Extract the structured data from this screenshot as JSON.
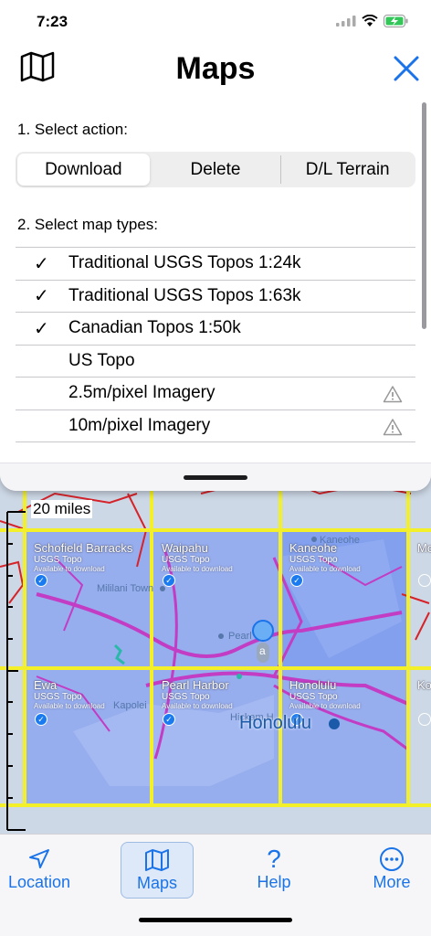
{
  "status_bar": {
    "time": "7:23"
  },
  "header": {
    "title": "Maps",
    "map_icon": "map-icon",
    "close_icon": "close-icon"
  },
  "action_section": {
    "label": "1. Select action:",
    "options": [
      "Download",
      "Delete",
      "D/L Terrain"
    ],
    "selected": "Download"
  },
  "map_types_section": {
    "label": "2. Select map types:",
    "items": [
      {
        "label": "Traditional USGS Topos 1:24k",
        "checked": "✓"
      },
      {
        "label": "Traditional USGS Topos 1:63k",
        "checked": "✓"
      },
      {
        "label": "Canadian Topos 1:50k",
        "checked": "✓"
      },
      {
        "label": "US Topo",
        "checked": ""
      },
      {
        "label": "2.5m/pixel Imagery",
        "checked": "",
        "warning_icon": "warning-icon"
      },
      {
        "label": "10m/pixel Imagery",
        "checked": "",
        "warning_icon": "warning-icon"
      }
    ]
  },
  "map": {
    "scale_label": "20 miles",
    "tiles": [
      {
        "name": "Schofield Barracks",
        "series": "USGS Topo",
        "status": "Available to download"
      },
      {
        "name": "Waipahu",
        "series": "USGS Topo",
        "status": "Available to download"
      },
      {
        "name": "Kaneohe",
        "series": "USGS Topo",
        "status": "Available to download"
      },
      {
        "name": "Ewa",
        "series": "USGS Topo",
        "status": "Available to download"
      },
      {
        "name": "Pearl Harbor",
        "series": "USGS Topo",
        "status": "Available to download"
      },
      {
        "name": "Honolulu",
        "series": "USGS Topo",
        "status": "Available to download"
      }
    ],
    "places": {
      "mililani": "Mililani Town",
      "pearl": "Pearl",
      "kapolei": "Kapolei",
      "kaneohe": "Kaneohe",
      "honolulu": "Honolulu",
      "hickam": "Hickam H"
    },
    "edge_tiles": {
      "right_top": "Mo",
      "right_bottom": "Ko"
    },
    "marker_letter": "a"
  },
  "tabbar": {
    "tabs": [
      {
        "label": "Location",
        "icon": "location-arrow-icon"
      },
      {
        "label": "Maps",
        "icon": "map-icon"
      },
      {
        "label": "Help",
        "icon": "question-icon"
      },
      {
        "label": "More",
        "icon": "ellipsis-circle-icon"
      }
    ],
    "active": "Maps"
  },
  "colors": {
    "accent": "#1a73e8",
    "grid": "#f3f02a",
    "tile_fill": "#8fa8f0",
    "roads": "#c23cc4",
    "boundary": "#d6232a"
  }
}
